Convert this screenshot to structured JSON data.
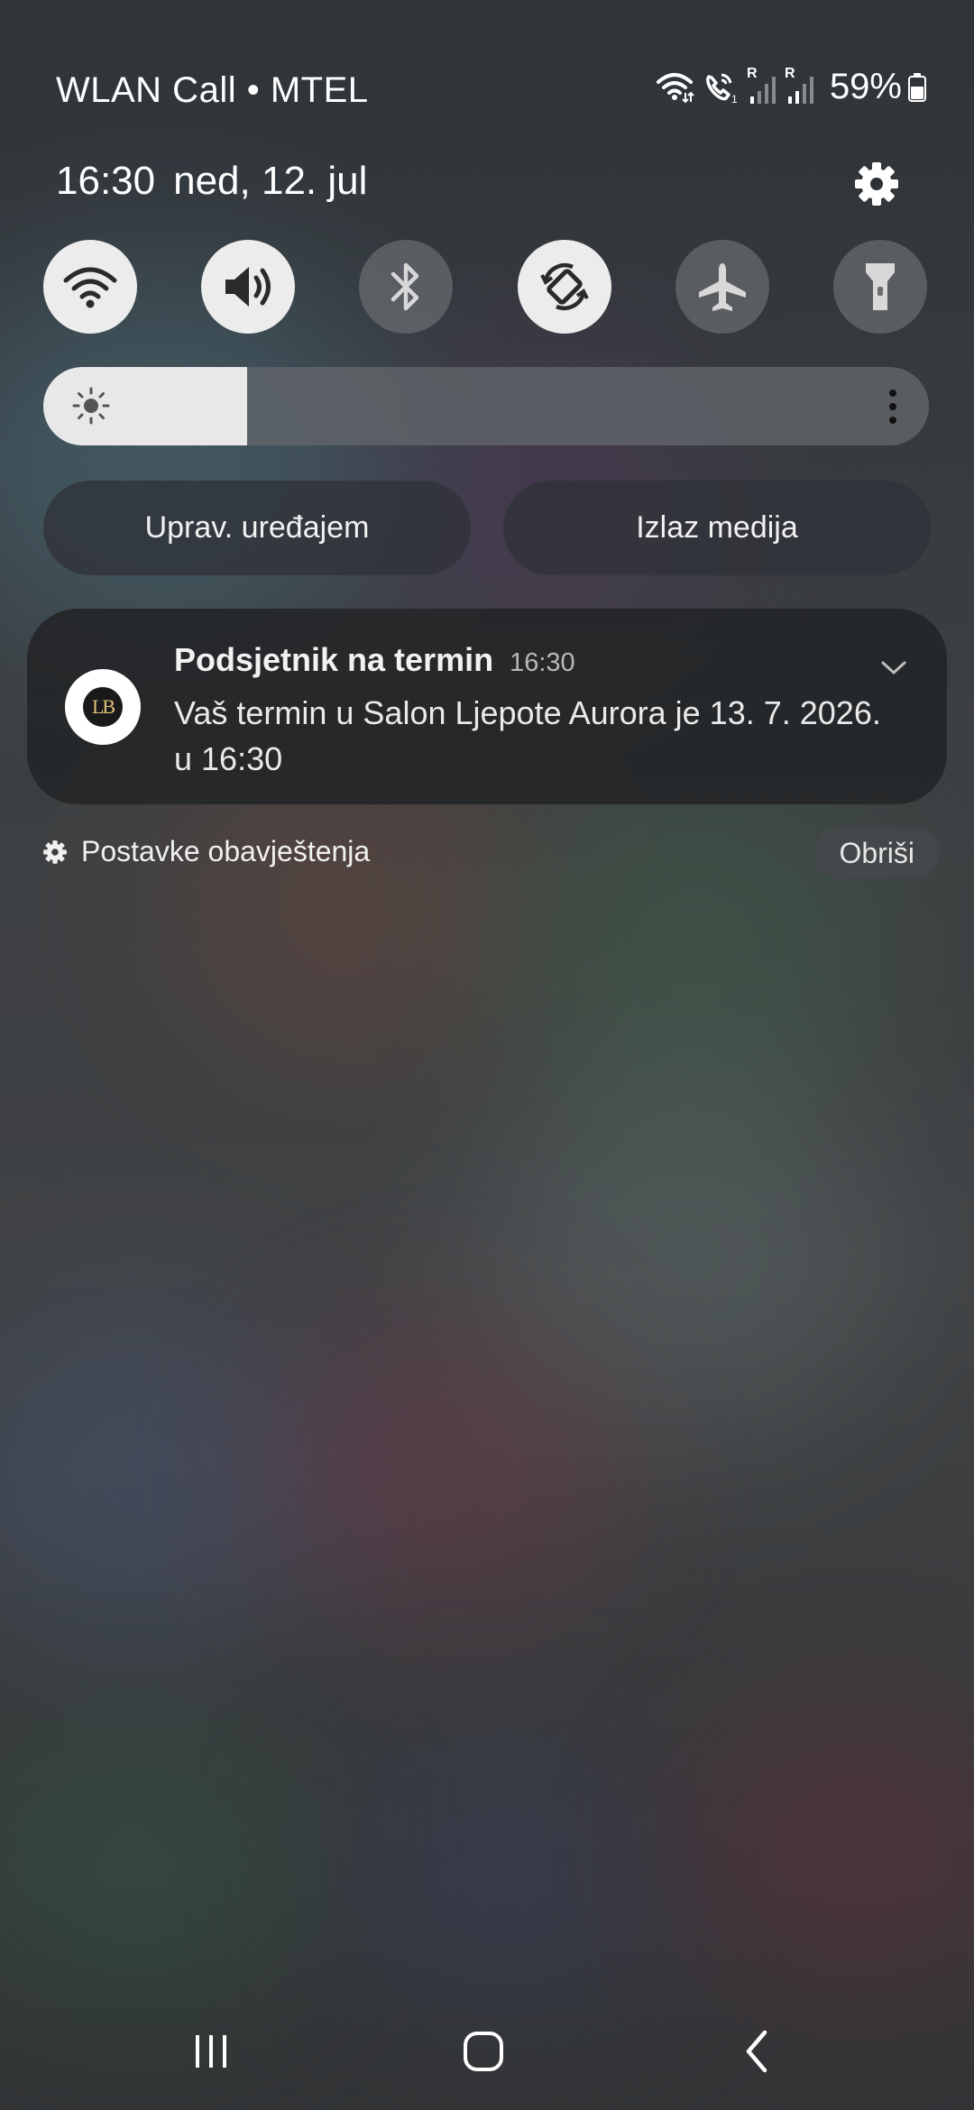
{
  "status_bar": {
    "carrier": "WLAN Call • MTEL",
    "roaming_1": "R",
    "roaming_2": "R",
    "battery": "59%",
    "icons": [
      "wifi-calling-icon",
      "volte-call-icon",
      "signal-1-icon",
      "signal-2-icon",
      "battery-icon"
    ]
  },
  "header": {
    "time": "16:30",
    "date": "ned, 12. jul"
  },
  "quick_settings": [
    {
      "name": "wifi",
      "icon": "wifi-icon",
      "on": true
    },
    {
      "name": "sound",
      "icon": "volume-icon",
      "on": true
    },
    {
      "name": "bluetooth",
      "icon": "bluetooth-icon",
      "on": false
    },
    {
      "name": "auto-rotate",
      "icon": "auto-rotate-icon",
      "on": true
    },
    {
      "name": "airplane-mode",
      "icon": "airplane-icon",
      "on": false
    },
    {
      "name": "flashlight",
      "icon": "flashlight-icon",
      "on": false
    }
  ],
  "brightness": {
    "level": 0.23
  },
  "buttons": {
    "device_control": "Uprav. uređajem",
    "media_output": "Izlaz medija"
  },
  "notification": {
    "app_initials": "LB",
    "title": "Podsjetnik na termin",
    "time": "16:30",
    "body": "Vaš termin u Salon Ljepote Aurora je 13. 7. 2026. u 16:30"
  },
  "footer": {
    "notification_settings": "Postavke obavještenja",
    "clear": "Obriši"
  },
  "colors": {
    "toggle_on": "#ececec",
    "toggle_off": "#6e7276",
    "panel": "#242628"
  }
}
